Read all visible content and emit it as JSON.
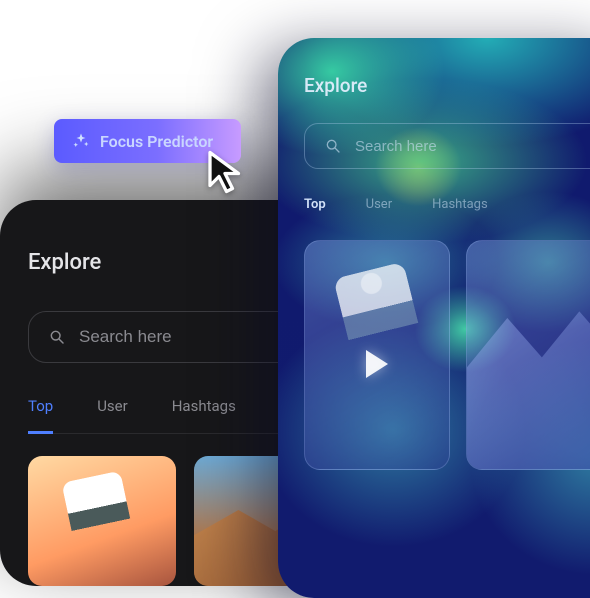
{
  "focus_predictor": {
    "label": "Focus Predictor"
  },
  "phone_dark": {
    "title": "Explore",
    "search_placeholder": "Search here",
    "tabs": [
      {
        "label": "Top",
        "active": true
      },
      {
        "label": "User",
        "active": false
      },
      {
        "label": "Hashtags",
        "active": false
      }
    ]
  },
  "phone_heat": {
    "title": "Explore",
    "search_placeholder": "Search here",
    "tabs": [
      {
        "label": "Top",
        "active": true
      },
      {
        "label": "User",
        "active": false
      },
      {
        "label": "Hashtags",
        "active": false
      }
    ]
  }
}
